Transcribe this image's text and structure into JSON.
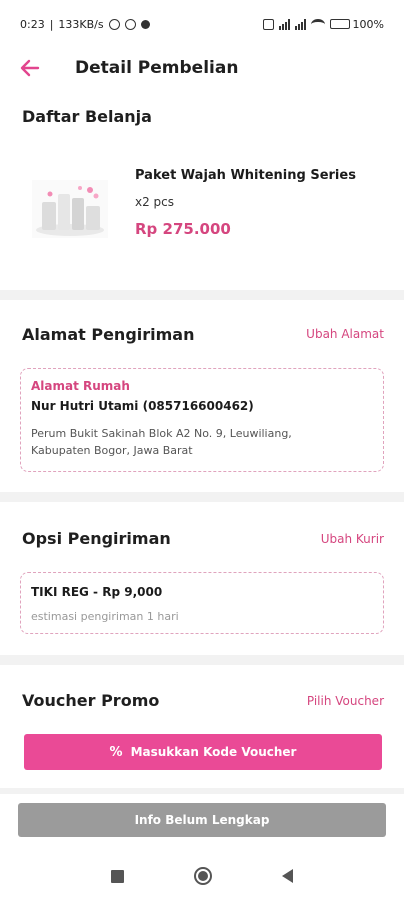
{
  "status_bar": {
    "time": "0:23",
    "speed": "133KB/s",
    "battery": "100%"
  },
  "header": {
    "back_icon": "arrow-left-icon",
    "title": "Detail Pembelian",
    "accent_color": "#e2458e"
  },
  "cart": {
    "title": "Daftar Belanja",
    "item": {
      "name": "Paket Wajah Whitening Series",
      "qty": "x2 pcs",
      "price": "Rp 275.000"
    }
  },
  "address": {
    "title": "Alamat Pengiriman",
    "change_label": "Ubah Alamat",
    "label": "Alamat Rumah",
    "recipient": "Nur Hutri Utami (085716600462)",
    "line1": "Perum Bukit Sakinah Blok A2 No. 9, Leuwiliang,",
    "line2": "Kabupaten Bogor, Jawa Barat"
  },
  "shipping": {
    "title": "Opsi Pengiriman",
    "change_label": "Ubah Kurir",
    "courier": "TIKI REG - Rp 9,000",
    "estimate": "estimasi pengiriman 1 hari"
  },
  "voucher": {
    "title": "Voucher Promo",
    "pick_label": "Pilih Voucher",
    "button_icon": "%",
    "button_label": "Masukkan Kode Voucher"
  },
  "submit": {
    "label": "Info Belum Lengkap"
  },
  "colors": {
    "primary": "#ea4a96",
    "link": "#d5467f",
    "disabled": "#9b9b9b"
  }
}
